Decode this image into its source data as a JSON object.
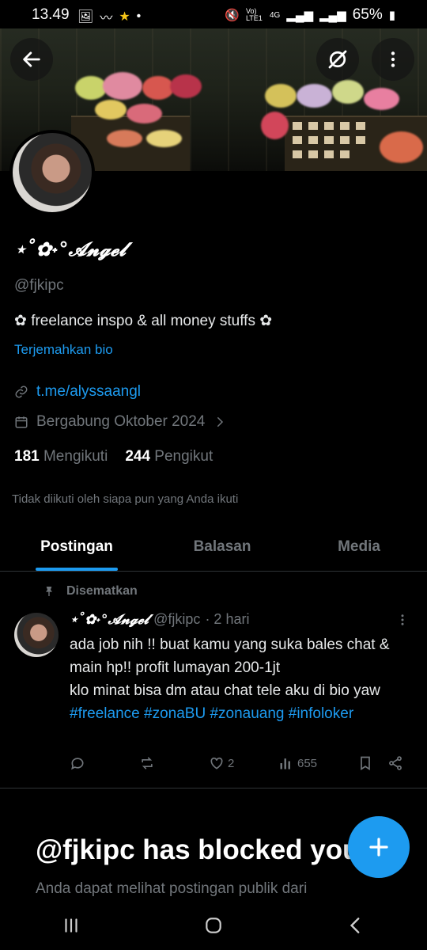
{
  "status_bar": {
    "time": "13.49",
    "battery": "65%",
    "network": "4G",
    "volte": "Vo) LTE1"
  },
  "profile": {
    "display_name": "⋆˚✿˖°𝓐𝓷𝓰𝓮𝓵",
    "handle": "@fjkipc",
    "bio": "✿ freelance inspo & all money stuffs ✿",
    "translate_bio": "Terjemahkan bio",
    "link": "t.me/alyssaangl",
    "joined": "Bergabung Oktober 2024",
    "following_count": "181",
    "following_label": "Mengikuti",
    "followers_count": "244",
    "followers_label": "Pengikut",
    "not_followed_note": "Tidak diikuti oleh siapa pun yang Anda ikuti"
  },
  "tabs": [
    {
      "label": "Postingan",
      "active": true
    },
    {
      "label": "Balasan",
      "active": false
    },
    {
      "label": "Media",
      "active": false
    }
  ],
  "pinned_tweet": {
    "pinned_label": "Disematkan",
    "author_name": "⋆˚✿˖°𝓐𝓷𝓰𝓮𝓵",
    "author_handle": "@fjkipc",
    "time": "· 2 hari",
    "text_line1": "ada job nih !! buat kamu yang suka bales chat & main hp!! profit lumayan 200-1jt",
    "text_line2": "klo minat bisa dm atau chat tele aku di bio yaw",
    "hashtags": "#freelance #zonaBU #zonauang #infoloker",
    "likes": "2",
    "views": "655"
  },
  "blocked": {
    "title": "@fjkipc has blocked you",
    "subtitle": "Anda dapat melihat postingan publik dari"
  },
  "colors": {
    "accent": "#1d9bf0",
    "muted": "#71767b",
    "background": "#000000",
    "divider": "#2f3336"
  },
  "icons": [
    "back-arrow-icon",
    "grok-icon",
    "more-vertical-icon",
    "link-icon",
    "calendar-icon",
    "chevron-right-icon",
    "pin-icon",
    "reply-icon",
    "retweet-icon",
    "like-icon",
    "views-icon",
    "bookmark-icon",
    "share-icon",
    "plus-icon",
    "recent-apps-icon",
    "home-icon",
    "back-nav-icon"
  ]
}
